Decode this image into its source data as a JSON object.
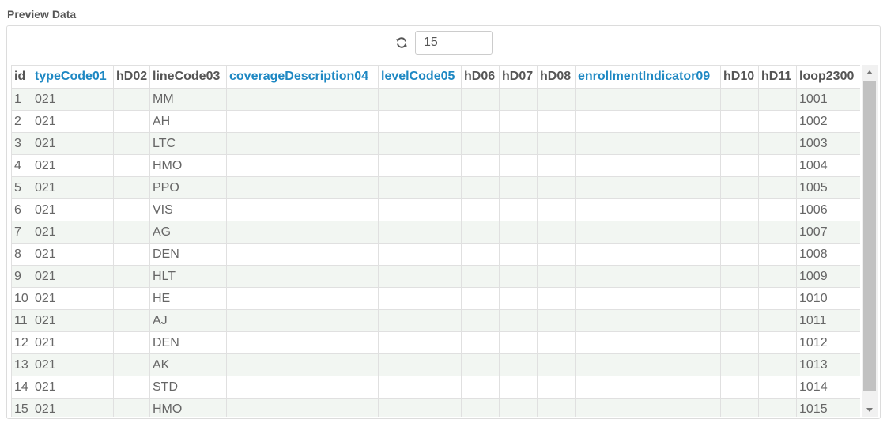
{
  "title": "Preview Data",
  "controls": {
    "row_count": "15",
    "refresh_icon": "refresh-icon"
  },
  "table": {
    "columns": [
      {
        "label": "id",
        "sortable": false
      },
      {
        "label": "typeCode01",
        "sortable": true
      },
      {
        "label": "hD02",
        "sortable": false
      },
      {
        "label": "lineCode03",
        "sortable": false
      },
      {
        "label": "coverageDescription04",
        "sortable": true
      },
      {
        "label": "levelCode05",
        "sortable": true
      },
      {
        "label": "hD06",
        "sortable": false
      },
      {
        "label": "hD07",
        "sortable": false
      },
      {
        "label": "hD08",
        "sortable": false
      },
      {
        "label": "enrollmentIndicator09",
        "sortable": true
      },
      {
        "label": "hD10",
        "sortable": false
      },
      {
        "label": "hD11",
        "sortable": false
      },
      {
        "label": "loop2300",
        "sortable": false
      }
    ],
    "rows": [
      [
        "1",
        "021",
        "",
        "MM",
        "",
        "",
        "",
        "",
        "",
        "",
        "",
        "",
        "1001"
      ],
      [
        "2",
        "021",
        "",
        "AH",
        "",
        "",
        "",
        "",
        "",
        "",
        "",
        "",
        "1002"
      ],
      [
        "3",
        "021",
        "",
        "LTC",
        "",
        "",
        "",
        "",
        "",
        "",
        "",
        "",
        "1003"
      ],
      [
        "4",
        "021",
        "",
        "HMO",
        "",
        "",
        "",
        "",
        "",
        "",
        "",
        "",
        "1004"
      ],
      [
        "5",
        "021",
        "",
        "PPO",
        "",
        "",
        "",
        "",
        "",
        "",
        "",
        "",
        "1005"
      ],
      [
        "6",
        "021",
        "",
        "VIS",
        "",
        "",
        "",
        "",
        "",
        "",
        "",
        "",
        "1006"
      ],
      [
        "7",
        "021",
        "",
        "AG",
        "",
        "",
        "",
        "",
        "",
        "",
        "",
        "",
        "1007"
      ],
      [
        "8",
        "021",
        "",
        "DEN",
        "",
        "",
        "",
        "",
        "",
        "",
        "",
        "",
        "1008"
      ],
      [
        "9",
        "021",
        "",
        "HLT",
        "",
        "",
        "",
        "",
        "",
        "",
        "",
        "",
        "1009"
      ],
      [
        "10",
        "021",
        "",
        "HE",
        "",
        "",
        "",
        "",
        "",
        "",
        "",
        "",
        "1010"
      ],
      [
        "11",
        "021",
        "",
        "AJ",
        "",
        "",
        "",
        "",
        "",
        "",
        "",
        "",
        "1011"
      ],
      [
        "12",
        "021",
        "",
        "DEN",
        "",
        "",
        "",
        "",
        "",
        "",
        "",
        "",
        "1012"
      ],
      [
        "13",
        "021",
        "",
        "AK",
        "",
        "",
        "",
        "",
        "",
        "",
        "",
        "",
        "1013"
      ],
      [
        "14",
        "021",
        "",
        "STD",
        "",
        "",
        "",
        "",
        "",
        "",
        "",
        "",
        "1014"
      ],
      [
        "15",
        "021",
        "",
        "HMO",
        "",
        "",
        "",
        "",
        "",
        "",
        "",
        "",
        "1015"
      ]
    ]
  },
  "colors": {
    "sortable_header": "#1e88c3",
    "stripe": "#f2f6f2"
  }
}
